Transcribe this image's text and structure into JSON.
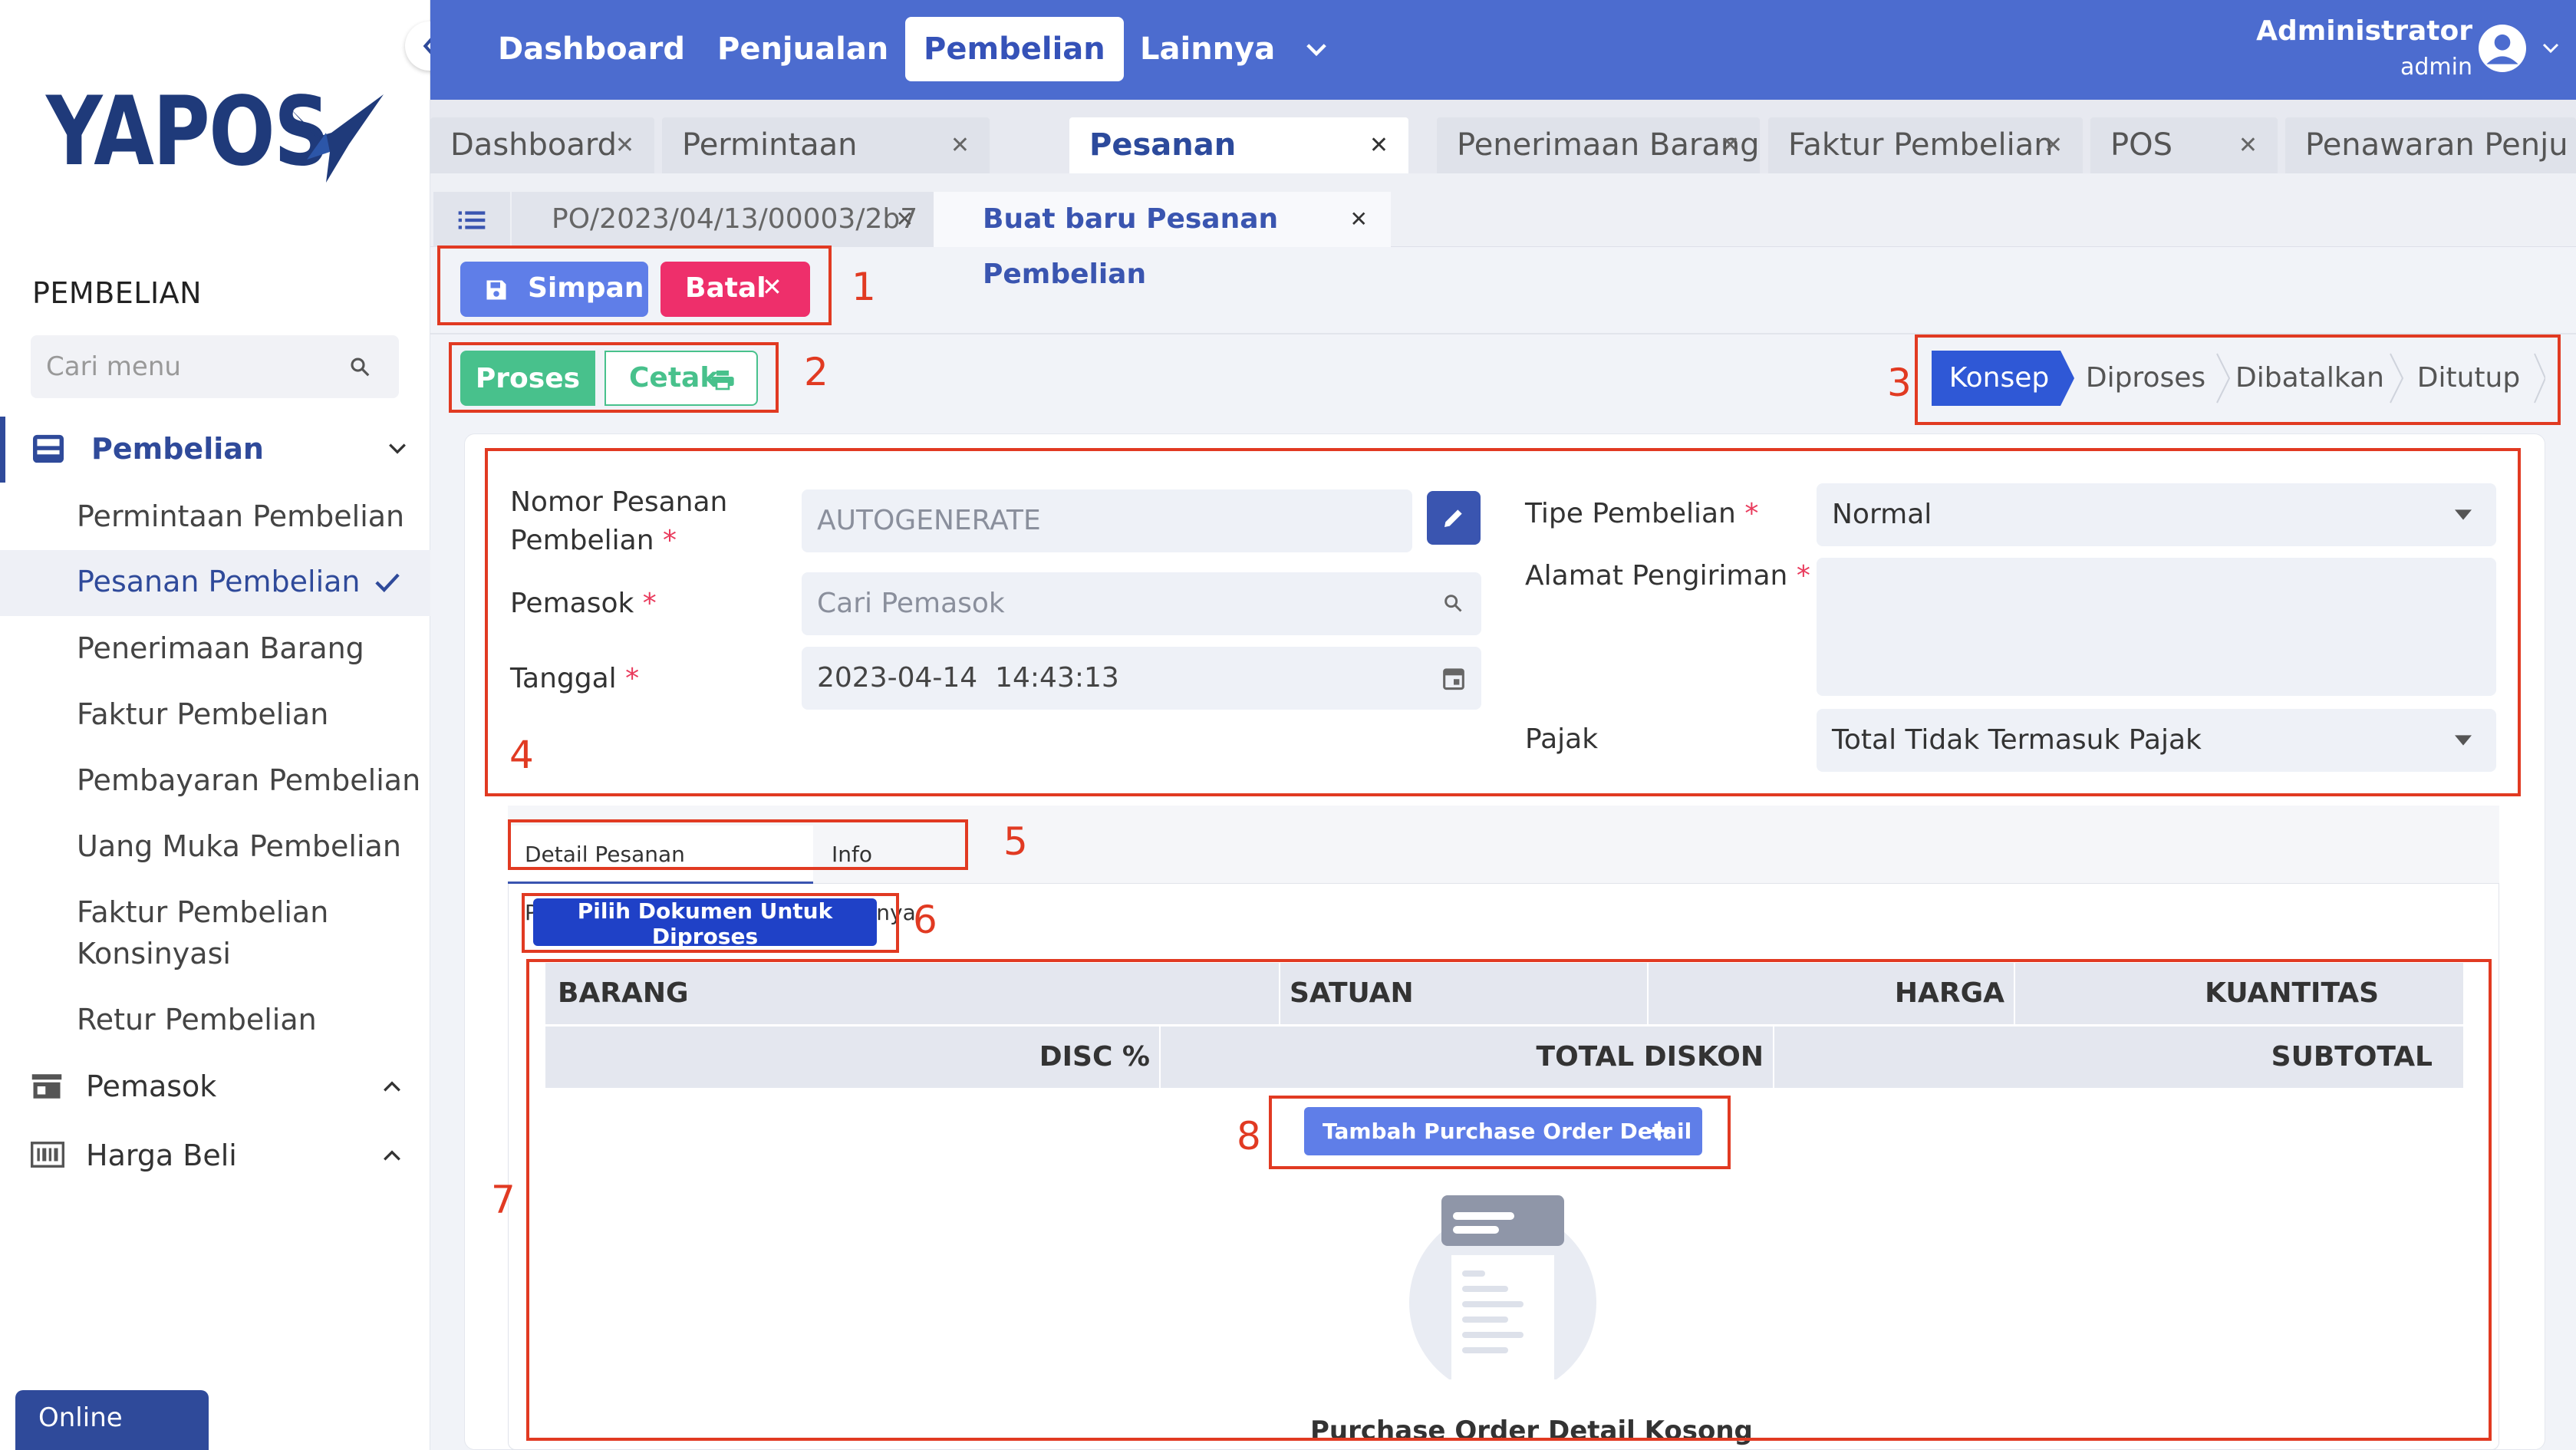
{
  "sidebar": {
    "logo": "YAPOS",
    "section_title": "PEMBELIAN",
    "search_placeholder": "Cari menu",
    "group_pembelian": "Pembelian",
    "items": [
      {
        "label": "Permintaan Pembelian"
      },
      {
        "label": "Pesanan Pembelian",
        "selected": true
      },
      {
        "label": "Penerimaan Barang"
      },
      {
        "label": "Faktur Pembelian"
      },
      {
        "label": "Pembayaran Pembelian"
      },
      {
        "label": "Uang Muka Pembelian"
      },
      {
        "label": "Faktur Pembelian",
        "label2": "Konsinyasi"
      },
      {
        "label": "Retur Pembelian"
      }
    ],
    "group_pemasok": "Pemasok",
    "group_harga": "Harga Beli",
    "online": "Online"
  },
  "topnav": {
    "items": [
      "Dashboard",
      "Penjualan",
      "Pembelian",
      "Lainnya"
    ],
    "active": "Pembelian",
    "user_name": "Administrator",
    "user_role": "admin"
  },
  "main_tabs": [
    "Dashboard",
    "Permintaan Pembelian",
    "Pesanan Pembelian",
    "Penerimaan Barang",
    "Faktur Pembelian",
    "POS",
    "Penawaran Penju"
  ],
  "sub_tabs": [
    "PO/2023/04/13/00003/2b7",
    "Buat baru Pesanan Pembelian"
  ],
  "toolbar": {
    "save": "Simpan",
    "cancel": "Batal",
    "process": "Proses",
    "print": "Cetak"
  },
  "status_steps": [
    "Konsep",
    "Diproses",
    "Dibatalkan",
    "Ditutup"
  ],
  "status_active": "Konsep",
  "form": {
    "nomor_label_1": "Nomor Pesanan",
    "nomor_label_2": "Pembelian",
    "nomor_value": "AUTOGENERATE",
    "pemasok_label": "Pemasok",
    "pemasok_placeholder": "Cari Pemasok",
    "tanggal_label": "Tanggal",
    "tanggal_value": "2023-04-14  14:43:13",
    "tipe_label": "Tipe Pembelian",
    "tipe_value": "Normal",
    "alamat_label": "Alamat Pengiriman",
    "alamat_value": "",
    "pajak_label": "Pajak",
    "pajak_value": "Total Tidak Termasuk Pajak"
  },
  "detail_tabs": [
    "Detail Pesanan Pembelian",
    "Info Lainnya"
  ],
  "pick_doc_button": "Pilih Dokumen Untuk Diproses",
  "table": {
    "row1_headers": [
      "BARANG",
      "SATUAN",
      "HARGA",
      "KUANTITAS"
    ],
    "row2_headers": [
      "DISC %",
      "TOTAL DISKON",
      "SUBTOTAL"
    ]
  },
  "add_detail_button": "Tambah Purchase Order Detail",
  "empty_text": "Purchase Order Detail Kosong",
  "annotations": [
    "1",
    "2",
    "3",
    "4",
    "5",
    "6",
    "7",
    "8"
  ],
  "colors": {
    "primary": "#4c6ccf",
    "danger": "#ee2f6b",
    "success": "#48c18c",
    "annotation": "#e13a22"
  }
}
